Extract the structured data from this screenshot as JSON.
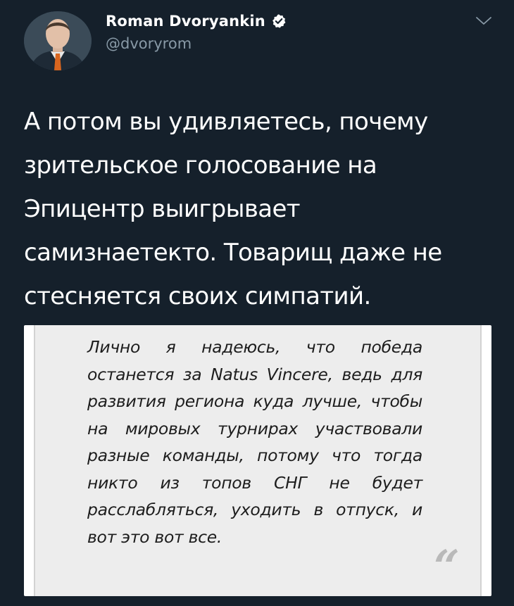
{
  "author": {
    "display_name": "Roman Dvoryankin",
    "handle": "@dvoryrom",
    "verified": true,
    "avatar_icon": "profile-photo"
  },
  "tweet": {
    "text": "А потом вы удивляетесь, почему зрительское голосование на Эпицентр выигрывает самизнаетекто. Товарищ даже не стесняется своих симпатий."
  },
  "media": {
    "quote_text": "Лично я надеюсь, что победа останется за Natus Vincere, ведь для развития региона куда лучше, чтобы на мировых турнирах участвовали разные команды, потому что тогда никто из топов СНГ не будет расслабляться, уходить в отпуск, и вот это вот все.",
    "quote_mark": "“"
  },
  "colors": {
    "background": "#15202b",
    "text_primary": "#ffffff",
    "text_secondary": "#8899a6",
    "verified_badge": "#ffffff"
  }
}
